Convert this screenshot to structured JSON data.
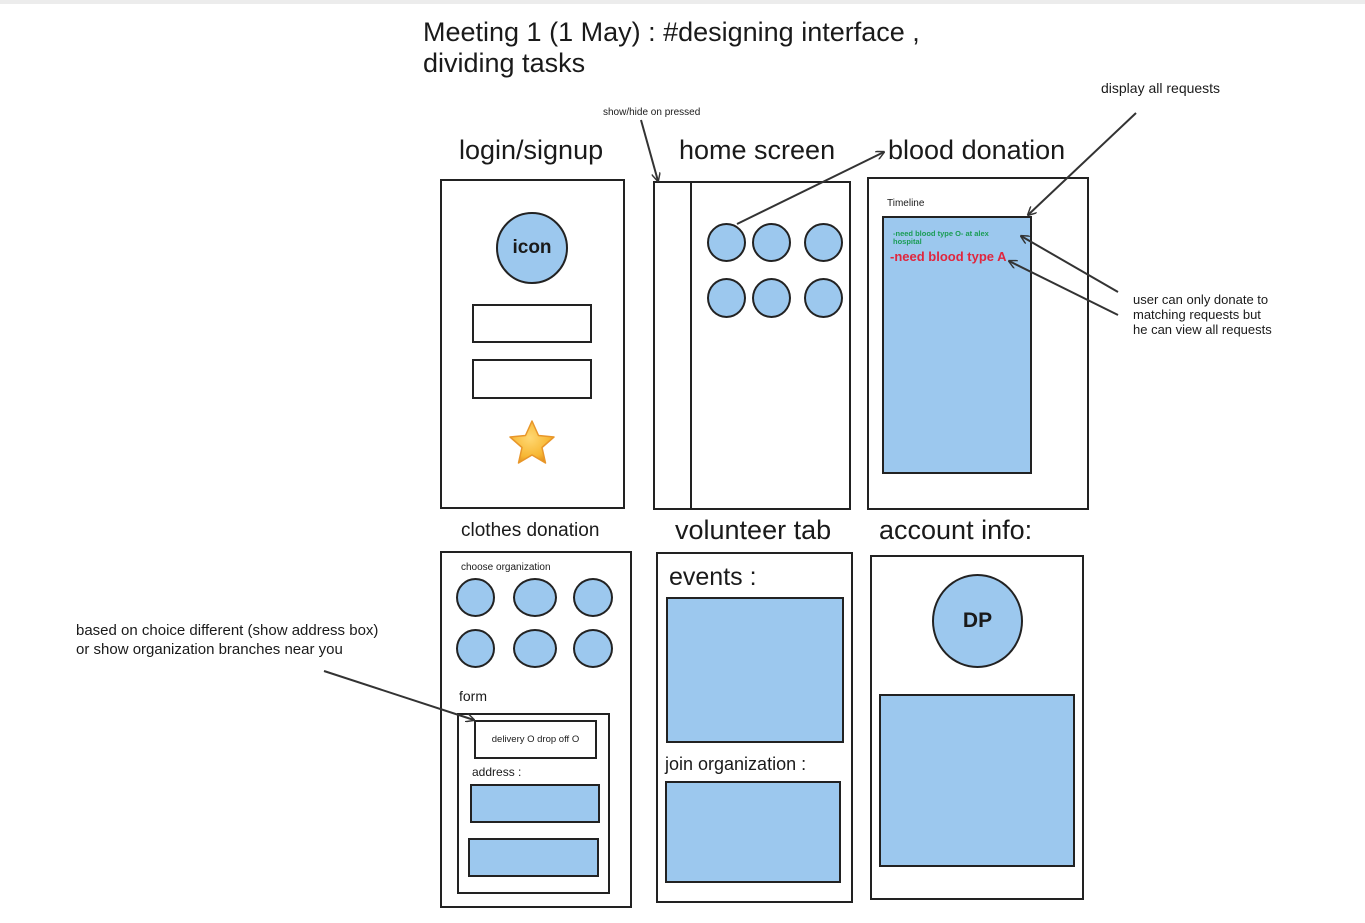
{
  "title_line1": "Meeting 1 (1 May) : #designing interface ,",
  "title_line2": "dividing tasks",
  "screens": {
    "login": {
      "title": "login/signup",
      "icon_label": "icon"
    },
    "home": {
      "title": "home screen",
      "sidebar_note": "show/hide on pressed"
    },
    "blood": {
      "title": "blood donation",
      "timeline_label": "Timeline",
      "request_1": "-need blood type O- at alex hospital",
      "request_2": "-need blood type A"
    },
    "clothes": {
      "title": "clothes donation",
      "choose_label": "choose organization",
      "form_label": "form",
      "delivery_label": "delivery O drop off O",
      "address_label": "address :"
    },
    "volunteer": {
      "title": "volunteer tab",
      "events_label": "events :",
      "join_label": "join organization :"
    },
    "account": {
      "title": "account info:",
      "dp_label": "DP"
    }
  },
  "notes": {
    "display_all": "display all requests",
    "donate_line1": "user can only donate to",
    "donate_line2": "matching requests but",
    "donate_line3": "he can view all requests",
    "choice_line1": "based on choice different (show address box)",
    "choice_line2": "or show organization branches near you"
  },
  "colors": {
    "fill": "#9cc8ee",
    "stroke": "#222222",
    "request_green": "#1a9c55",
    "request_red": "#e0263e",
    "star": "#f7b733"
  }
}
